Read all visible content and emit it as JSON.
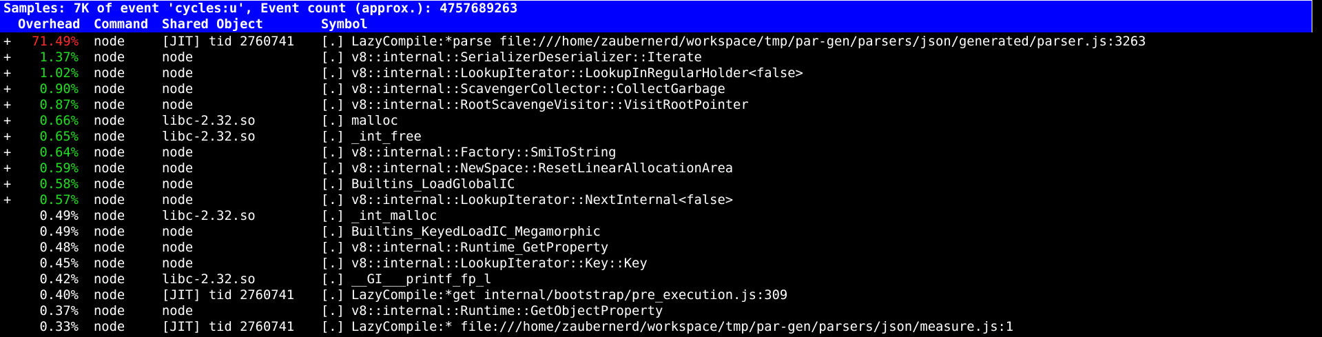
{
  "colors": {
    "background": "#000000",
    "foreground": "#ffffff",
    "header_bar": "#0000ff",
    "hot": "#ff2b2b",
    "warm": "#22dd22"
  },
  "summary": "Samples: 7K of event 'cycles:u', Event count (approx.): 4757689263",
  "columns": {
    "overhead": "Overhead",
    "command": "Command",
    "shared_object": "Shared Object",
    "symbol": "Symbol"
  },
  "rows": [
    {
      "expander": "+",
      "overhead": "71.49%",
      "color": "hot",
      "command": "node",
      "shared_object": "[JIT] tid 2760741",
      "level": "[.]",
      "symbol": "LazyCompile:*parse file:///home/zaubernerd/workspace/tmp/par-gen/parsers/json/generated/parser.js:3263"
    },
    {
      "expander": "+",
      "overhead": "1.37%",
      "color": "warm",
      "command": "node",
      "shared_object": "node",
      "level": "[.]",
      "symbol": "v8::internal::SerializerDeserializer::Iterate"
    },
    {
      "expander": "+",
      "overhead": "1.02%",
      "color": "warm",
      "command": "node",
      "shared_object": "node",
      "level": "[.]",
      "symbol": "v8::internal::LookupIterator::LookupInRegularHolder<false>"
    },
    {
      "expander": "+",
      "overhead": "0.90%",
      "color": "warm",
      "command": "node",
      "shared_object": "node",
      "level": "[.]",
      "symbol": "v8::internal::ScavengerCollector::CollectGarbage"
    },
    {
      "expander": "+",
      "overhead": "0.87%",
      "color": "warm",
      "command": "node",
      "shared_object": "node",
      "level": "[.]",
      "symbol": "v8::internal::RootScavengeVisitor::VisitRootPointer"
    },
    {
      "expander": "+",
      "overhead": "0.66%",
      "color": "warm",
      "command": "node",
      "shared_object": "libc-2.32.so",
      "level": "[.]",
      "symbol": "malloc"
    },
    {
      "expander": "+",
      "overhead": "0.65%",
      "color": "warm",
      "command": "node",
      "shared_object": "libc-2.32.so",
      "level": "[.]",
      "symbol": "_int_free"
    },
    {
      "expander": "+",
      "overhead": "0.64%",
      "color": "warm",
      "command": "node",
      "shared_object": "node",
      "level": "[.]",
      "symbol": "v8::internal::Factory::SmiToString"
    },
    {
      "expander": "+",
      "overhead": "0.59%",
      "color": "warm",
      "command": "node",
      "shared_object": "node",
      "level": "[.]",
      "symbol": "v8::internal::NewSpace::ResetLinearAllocationArea"
    },
    {
      "expander": "+",
      "overhead": "0.58%",
      "color": "warm",
      "command": "node",
      "shared_object": "node",
      "level": "[.]",
      "symbol": "Builtins_LoadGlobalIC"
    },
    {
      "expander": "+",
      "overhead": "0.57%",
      "color": "warm",
      "command": "node",
      "shared_object": "node",
      "level": "[.]",
      "symbol": "v8::internal::LookupIterator::NextInternal<false>"
    },
    {
      "expander": "",
      "overhead": "0.49%",
      "color": "plain",
      "command": "node",
      "shared_object": "libc-2.32.so",
      "level": "[.]",
      "symbol": "_int_malloc"
    },
    {
      "expander": "",
      "overhead": "0.49%",
      "color": "plain",
      "command": "node",
      "shared_object": "node",
      "level": "[.]",
      "symbol": "Builtins_KeyedLoadIC_Megamorphic"
    },
    {
      "expander": "",
      "overhead": "0.48%",
      "color": "plain",
      "command": "node",
      "shared_object": "node",
      "level": "[.]",
      "symbol": "v8::internal::Runtime_GetProperty"
    },
    {
      "expander": "",
      "overhead": "0.45%",
      "color": "plain",
      "command": "node",
      "shared_object": "node",
      "level": "[.]",
      "symbol": "v8::internal::LookupIterator::Key::Key"
    },
    {
      "expander": "",
      "overhead": "0.42%",
      "color": "plain",
      "command": "node",
      "shared_object": "libc-2.32.so",
      "level": "[.]",
      "symbol": "__GI___printf_fp_l"
    },
    {
      "expander": "",
      "overhead": "0.40%",
      "color": "plain",
      "command": "node",
      "shared_object": "[JIT] tid 2760741",
      "level": "[.]",
      "symbol": "LazyCompile:*get internal/bootstrap/pre_execution.js:309"
    },
    {
      "expander": "",
      "overhead": "0.37%",
      "color": "plain",
      "command": "node",
      "shared_object": "node",
      "level": "[.]",
      "symbol": "v8::internal::Runtime::GetObjectProperty"
    },
    {
      "expander": "",
      "overhead": "0.33%",
      "color": "plain",
      "command": "node",
      "shared_object": "[JIT] tid 2760741",
      "level": "[.]",
      "symbol": "LazyCompile:* file:///home/zaubernerd/workspace/tmp/par-gen/parsers/json/measure.js:1"
    }
  ]
}
